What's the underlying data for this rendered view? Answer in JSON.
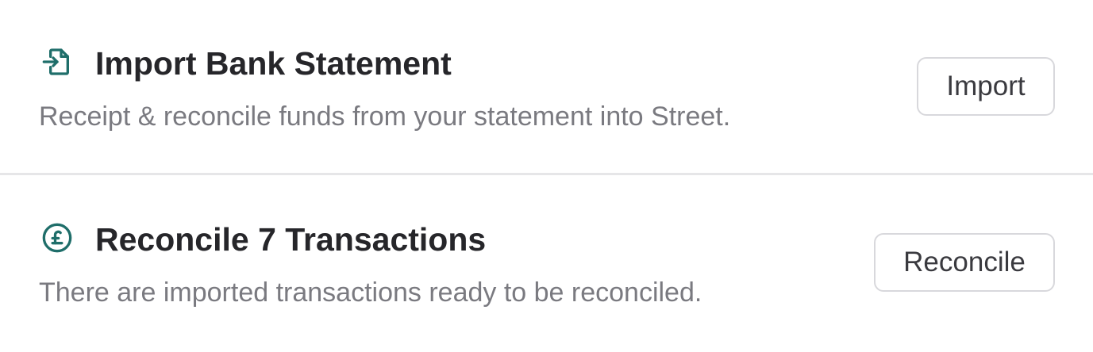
{
  "tasks": [
    {
      "icon": "file-import-icon",
      "title": "Import Bank Statement",
      "description": "Receipt & reconcile funds from your statement into Street.",
      "button_label": "Import"
    },
    {
      "icon": "pound-circle-icon",
      "title": "Reconcile 7 Transactions",
      "description": "There are imported transactions ready to be reconciled.",
      "button_label": "Reconcile"
    }
  ],
  "colors": {
    "accent": "#1f6e6a",
    "title": "#26262a",
    "description": "#7a7a80",
    "button_border": "#d8d8dc",
    "divider": "#e6e6e8"
  }
}
